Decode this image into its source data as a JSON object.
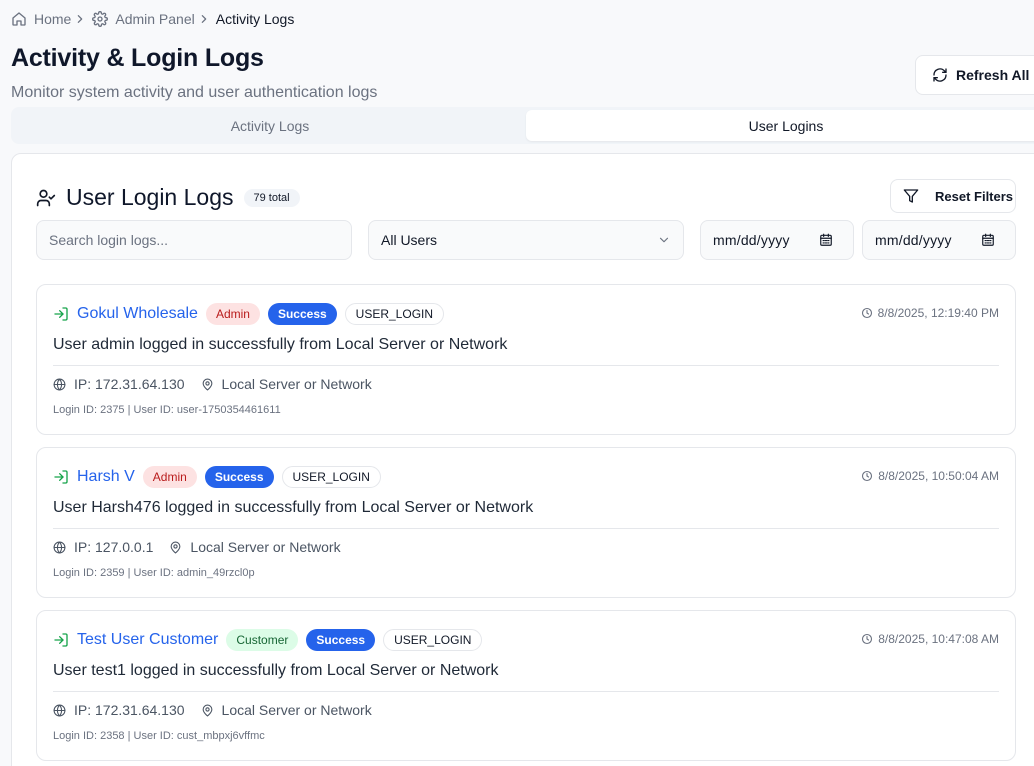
{
  "breadcrumb": {
    "home": "Home",
    "admin": "Admin Panel",
    "current": "Activity Logs"
  },
  "header": {
    "title": "Activity & Login Logs",
    "subtitle": "Monitor system activity and user authentication logs",
    "refresh_label": "Refresh All"
  },
  "tabs": [
    {
      "label": "Activity Logs",
      "active": false
    },
    {
      "label": "User Logins",
      "active": true
    }
  ],
  "section": {
    "title": "User Login Logs",
    "total": "79 total",
    "reset_label": "Reset Filters"
  },
  "filters": {
    "search_placeholder": "Search login logs...",
    "user_select": "All Users",
    "date_from": "mm/dd/yyyy",
    "date_to": "mm/dd/yyyy"
  },
  "logs": [
    {
      "name": "Gokul Wholesale",
      "role": "Admin",
      "status": "Success",
      "event": "USER_LOGIN",
      "time": "8/8/2025, 12:19:40 PM",
      "message": "User admin logged in successfully from Local Server or Network",
      "ip": "IP: 172.31.64.130",
      "location": "Local Server or Network",
      "ids": "Login ID: 2375 | User ID: user-1750354461611"
    },
    {
      "name": "Harsh V",
      "role": "Admin",
      "status": "Success",
      "event": "USER_LOGIN",
      "time": "8/8/2025, 10:50:04 AM",
      "message": "User Harsh476 logged in successfully from Local Server or Network",
      "ip": "IP: 127.0.0.1",
      "location": "Local Server or Network",
      "ids": "Login ID: 2359 | User ID: admin_49rzcl0p"
    },
    {
      "name": "Test User Customer",
      "role": "Customer",
      "status": "Success",
      "event": "USER_LOGIN",
      "time": "8/8/2025, 10:47:08 AM",
      "message": "User test1 logged in successfully from Local Server or Network",
      "ip": "IP: 172.31.64.130",
      "location": "Local Server or Network",
      "ids": "Login ID: 2358 | User ID: cust_mbpxj6vffmc"
    }
  ],
  "colors": {
    "accent": "#2563eb",
    "admin_badge_bg": "#fde2e2",
    "customer_badge_bg": "#dcfce7",
    "login_icon": "#16a34a"
  }
}
